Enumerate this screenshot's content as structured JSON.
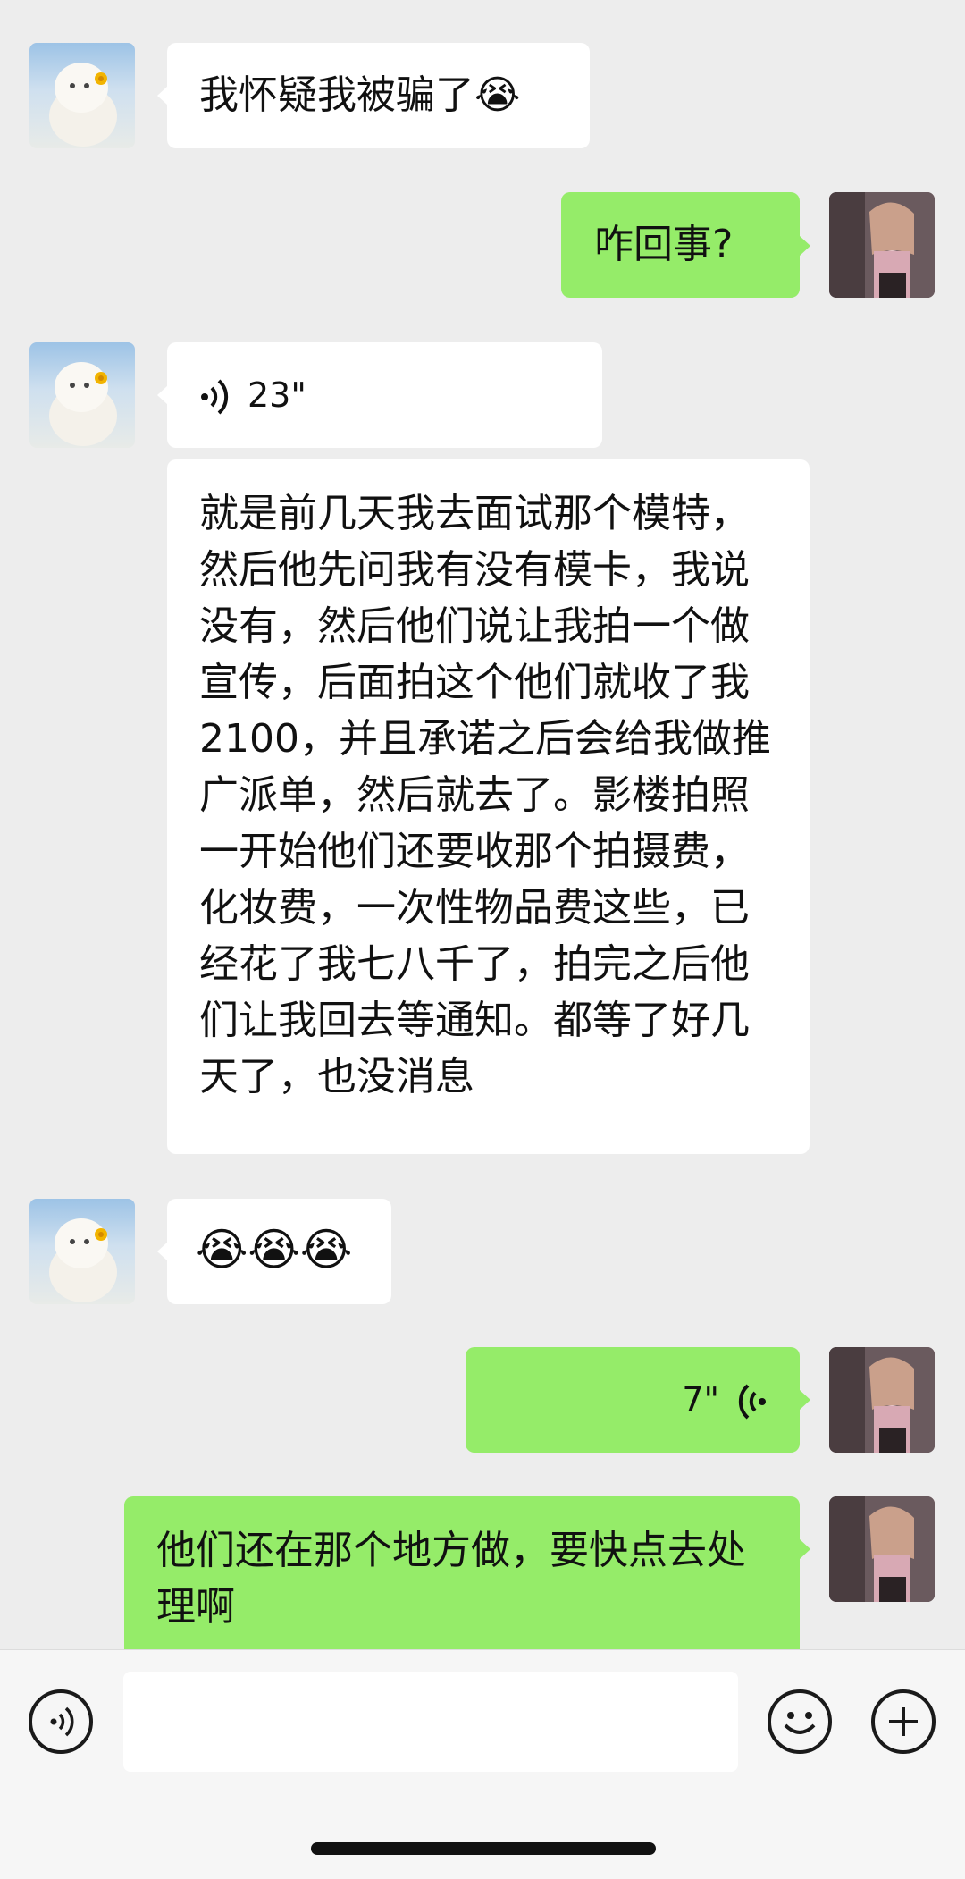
{
  "messages": [
    {
      "sender": "other",
      "text": "我怀疑我被骗了😭"
    },
    {
      "sender": "self",
      "text": "咋回事?"
    },
    {
      "sender": "other",
      "type": "voice",
      "duration": "23\""
    },
    {
      "sender": "other",
      "text": "就是前几天我去面试那个模特，然后他先问我有没有模卡，我说没有，然后他们说让我拍一个做宣传，后面拍这个他们就收了我2100，并且承诺之后会给我做推广派单，然后就去了。影楼拍照一开始他们还要收那个拍摄费，化妆费，一次性物品费这些，已经花了我七八千了，拍完之后他们让我回去等通知。都等了好几天了，也没消息"
    },
    {
      "sender": "other",
      "text": "😭😭😭"
    },
    {
      "sender": "self",
      "type": "voice",
      "duration": "7\""
    },
    {
      "sender": "self",
      "text": "他们还在那个地方做，要快点去处理啊"
    }
  ],
  "icons": {
    "voice_toggle": "voice-input-icon",
    "emoji": "emoji-icon",
    "more": "plus-icon"
  },
  "colors": {
    "background": "#ededed",
    "self_bubble": "#95ec69",
    "other_bubble": "#ffffff"
  }
}
